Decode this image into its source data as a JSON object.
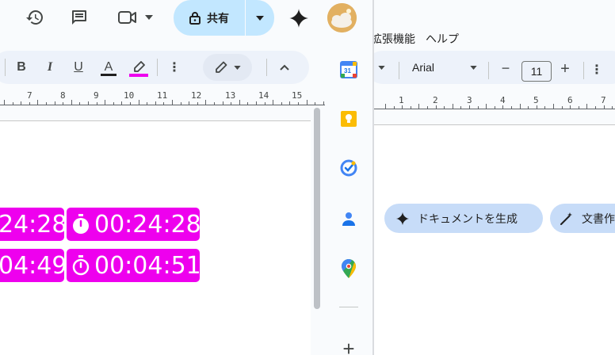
{
  "header": {
    "share_label": "共有"
  },
  "menubar": {
    "items": [
      "拡張機能",
      "ヘルプ"
    ]
  },
  "left_toolbar": {
    "bold": "B",
    "italic": "I",
    "underline": "U",
    "text_color": "A",
    "more": "⋮",
    "collapse": "^"
  },
  "left_ruler": {
    "numbers": [
      "7",
      "8",
      "9",
      "10",
      "11",
      "12",
      "13",
      "14",
      "15"
    ]
  },
  "timers": {
    "row1": {
      "left": "24:28",
      "right": "00:24:28"
    },
    "row2": {
      "left": "04:49",
      "right": "00:04:51"
    },
    "highlight_color": "#ee00ee"
  },
  "side_panel": {
    "apps": [
      "calendar-icon",
      "keep-icon",
      "tasks-icon",
      "contacts-icon",
      "maps-icon"
    ],
    "calendar_day": "31",
    "add_label": "+"
  },
  "right_toolbar": {
    "font": "Arial",
    "font_size": "11",
    "minus": "−",
    "plus": "+",
    "more": "⋮"
  },
  "right_ruler": {
    "numbers": [
      "1",
      "1",
      "2",
      "3",
      "4",
      "5",
      "6",
      "7"
    ]
  },
  "chips": {
    "generate_doc": "ドキュメントを生成",
    "rewrite": "文書作"
  }
}
